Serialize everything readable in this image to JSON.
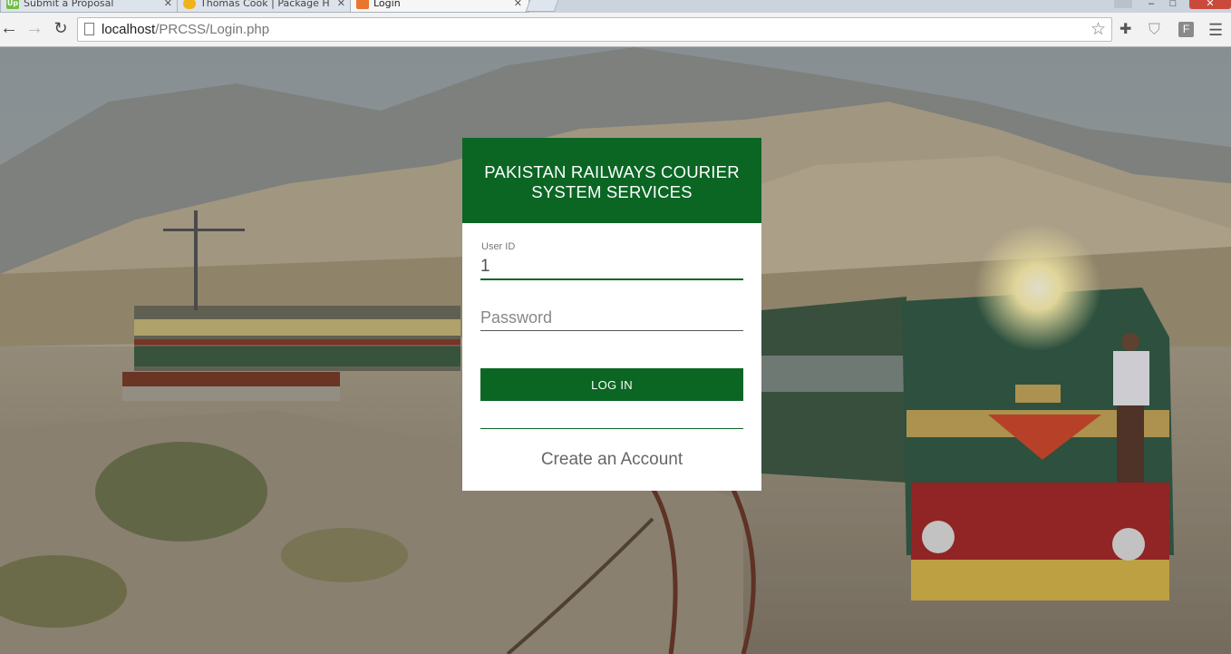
{
  "browser": {
    "tabs": [
      {
        "title": "Submit a Proposal",
        "favicon": "Up",
        "favicon_color": "#6fbe44",
        "active": false
      },
      {
        "title": "Thomas Cook | Package H",
        "favicon": "",
        "favicon_color": "#f0b21b",
        "active": false
      },
      {
        "title": "Login",
        "favicon": "",
        "favicon_color": "#e8762d",
        "active": true
      }
    ],
    "tab_close_glyph": "✕",
    "url_host": "localhost",
    "url_path": "/PRCSS/Login.php",
    "window_controls": {
      "minimize": "–",
      "maximize": "□",
      "close": "✕"
    },
    "icons": {
      "back": "arrow-left-icon",
      "forward": "arrow-right-icon",
      "reload": "reload-icon",
      "bookmark": "star-icon",
      "extensions": [
        "puzzle-icon",
        "shield-icon",
        "f-extension-icon"
      ],
      "menu": "hamburger-menu-icon"
    },
    "extension_f_label": "F"
  },
  "login": {
    "heading_line1": "PAKISTAN RAILWAYS COURIER",
    "heading_line2": "SYSTEM SERVICES",
    "user_id_label": "User ID",
    "user_id_value": "1",
    "password_placeholder": "Password",
    "login_button": "LOG IN",
    "create_account": "Create an Account",
    "brand_color": "#0b6624"
  }
}
